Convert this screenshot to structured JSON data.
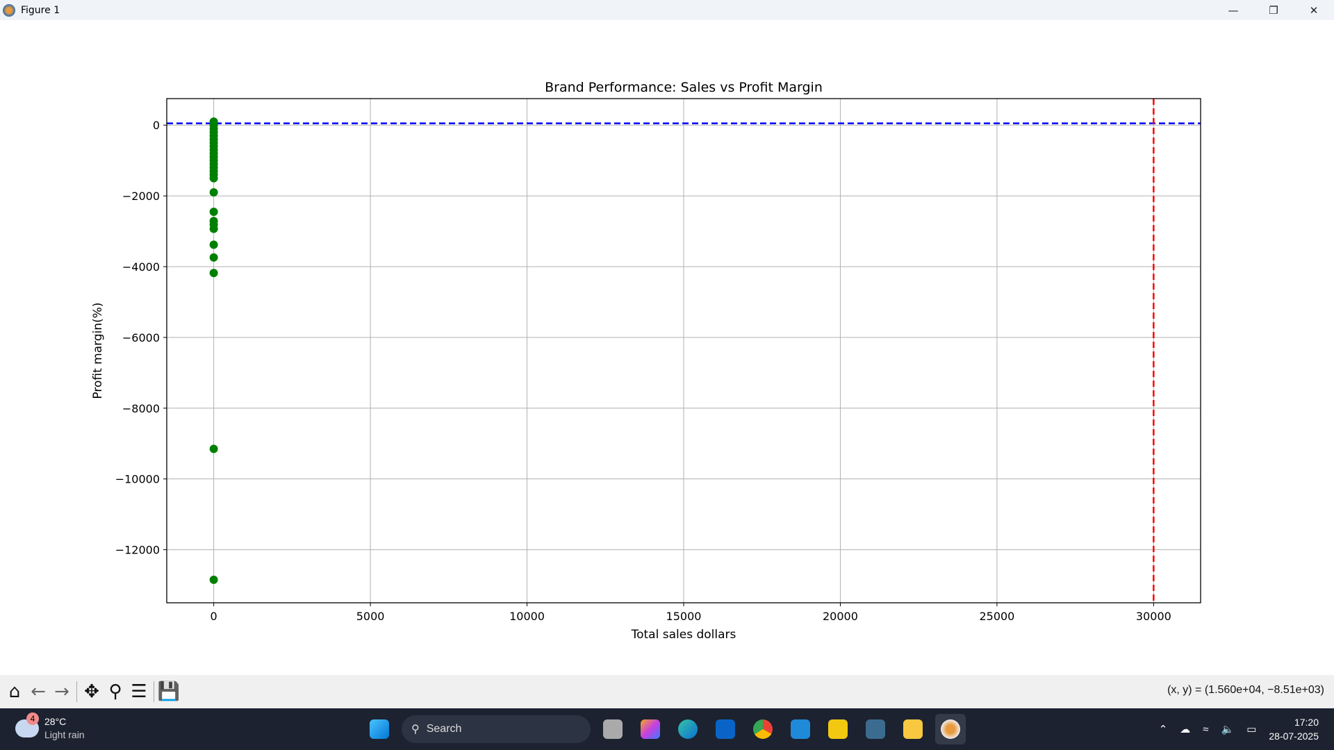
{
  "window": {
    "title": "Figure 1",
    "controls": [
      "minimize",
      "restore",
      "close"
    ]
  },
  "toolbar": {
    "icons": [
      "home-icon",
      "back-icon",
      "forward-icon",
      "pan-icon",
      "zoom-icon",
      "configure-subplots-icon",
      "save-icon"
    ],
    "coords": "(x, y) = (1.560e+04, −8.51e+03)"
  },
  "chart_data": {
    "type": "scatter",
    "title": "Brand Performance: Sales vs Profit Margin",
    "xlabel": "Total sales dollars",
    "ylabel": "Profit margin(%)",
    "xlim": [
      -1500,
      31500
    ],
    "ylim": [
      -13500,
      750
    ],
    "xticks": [
      0,
      5000,
      10000,
      15000,
      20000,
      25000,
      30000
    ],
    "xtick_labels": [
      "0",
      "5000",
      "10000",
      "15000",
      "20000",
      "25000",
      "30000"
    ],
    "yticks": [
      0,
      -2000,
      -4000,
      -6000,
      -8000,
      -10000,
      -12000
    ],
    "ytick_labels": [
      "0",
      "−2000",
      "−4000",
      "−6000",
      "−8000",
      "−10000",
      "−12000"
    ],
    "grid": true,
    "point_color": "#008000",
    "points": [
      [
        0,
        100
      ],
      [
        0,
        0
      ],
      [
        0,
        -100
      ],
      [
        0,
        -200
      ],
      [
        0,
        -300
      ],
      [
        0,
        -400
      ],
      [
        0,
        -500
      ],
      [
        0,
        -600
      ],
      [
        0,
        -700
      ],
      [
        0,
        -800
      ],
      [
        0,
        -900
      ],
      [
        0,
        -1000
      ],
      [
        0,
        -1100
      ],
      [
        0,
        -1200
      ],
      [
        0,
        -1300
      ],
      [
        0,
        -1400
      ],
      [
        0,
        -1500
      ],
      [
        0,
        -1900
      ],
      [
        0,
        -2450
      ],
      [
        0,
        -2710
      ],
      [
        0,
        -2810
      ],
      [
        0,
        -2930
      ],
      [
        0,
        -3380
      ],
      [
        0,
        -3740
      ],
      [
        0,
        -4180
      ],
      [
        0,
        -9150
      ],
      [
        0,
        -12850
      ]
    ],
    "hline": {
      "y": 50,
      "color": "#0000ff",
      "style": "dashed"
    },
    "vline": {
      "x": 30000,
      "color": "#ff0000",
      "style": "dashed"
    }
  },
  "taskbar": {
    "weather": {
      "badge": "4",
      "temp": "28°C",
      "desc": "Light rain"
    },
    "search_placeholder": "Search",
    "apps": [
      "windows-start",
      "task-view",
      "copilot",
      "edge",
      "outlook",
      "chrome",
      "vscode",
      "power-bi",
      "mysql-workbench",
      "file-explorer",
      "matplotlib-figure"
    ],
    "time": "17:20",
    "date": "28-07-2025"
  }
}
